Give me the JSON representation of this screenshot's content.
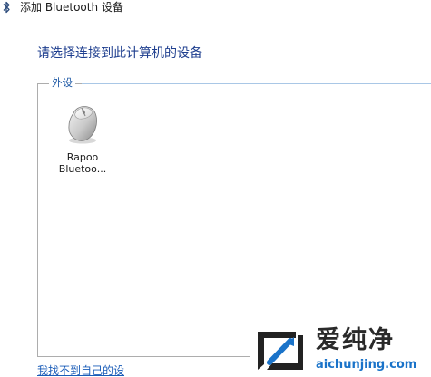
{
  "window": {
    "title": "添加 Bluetooth 设备",
    "icon": "bluetooth-icon"
  },
  "instruction": "请选择连接到此计算机的设备",
  "device_group": {
    "label": "外设",
    "devices": [
      {
        "icon": "mouse-icon",
        "name_line1": "Rapoo",
        "name_line2": "Bluetoo..."
      }
    ]
  },
  "link": {
    "cant_find": "我找不到自己的设"
  },
  "watermark": {
    "logo": "aichunjing-logo",
    "text": "爱纯净",
    "url": "aichunjing.com"
  },
  "colors": {
    "instruction": "#1f3f8f",
    "group_label": "#1f5aa6",
    "link": "#1a5cb8",
    "watermark_url": "#1a73c9"
  }
}
